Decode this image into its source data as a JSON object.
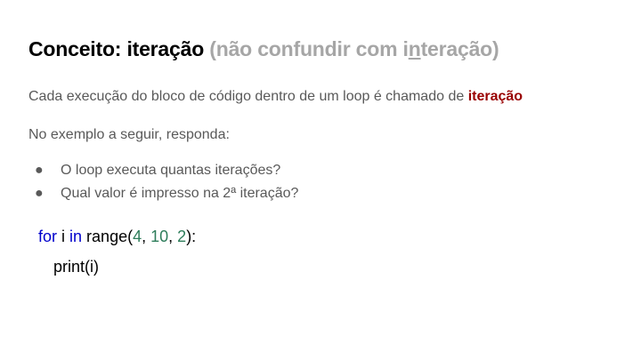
{
  "slide": {
    "title": {
      "main": "Conceito: iteração",
      "aside_prefix": "(não confundir com i",
      "aside_underlined": "n",
      "aside_suffix": "teração)"
    },
    "paragraph1": {
      "text": "Cada execução do bloco de código dentro de um loop é chamado de ",
      "highlight": "iteração"
    },
    "paragraph2": "No exemplo a seguir, responda:",
    "bullets": [
      "O loop executa quantas iterações?",
      "Qual valor é impresso na 2ª iteração?"
    ],
    "code": {
      "line1": {
        "kw_for": "for",
        "var": " i ",
        "kw_in": "in",
        "func": " range(",
        "arg1": "4",
        "sep1": ", ",
        "arg2": "10",
        "sep2": ", ",
        "arg3": "2",
        "close": "):"
      },
      "line2": "print(i)"
    },
    "colors": {
      "highlight": "#990000",
      "aside": "#a6a6a6",
      "body_text": "#595959",
      "keyword": "#0000cc",
      "number": "#2e7d5b"
    }
  }
}
